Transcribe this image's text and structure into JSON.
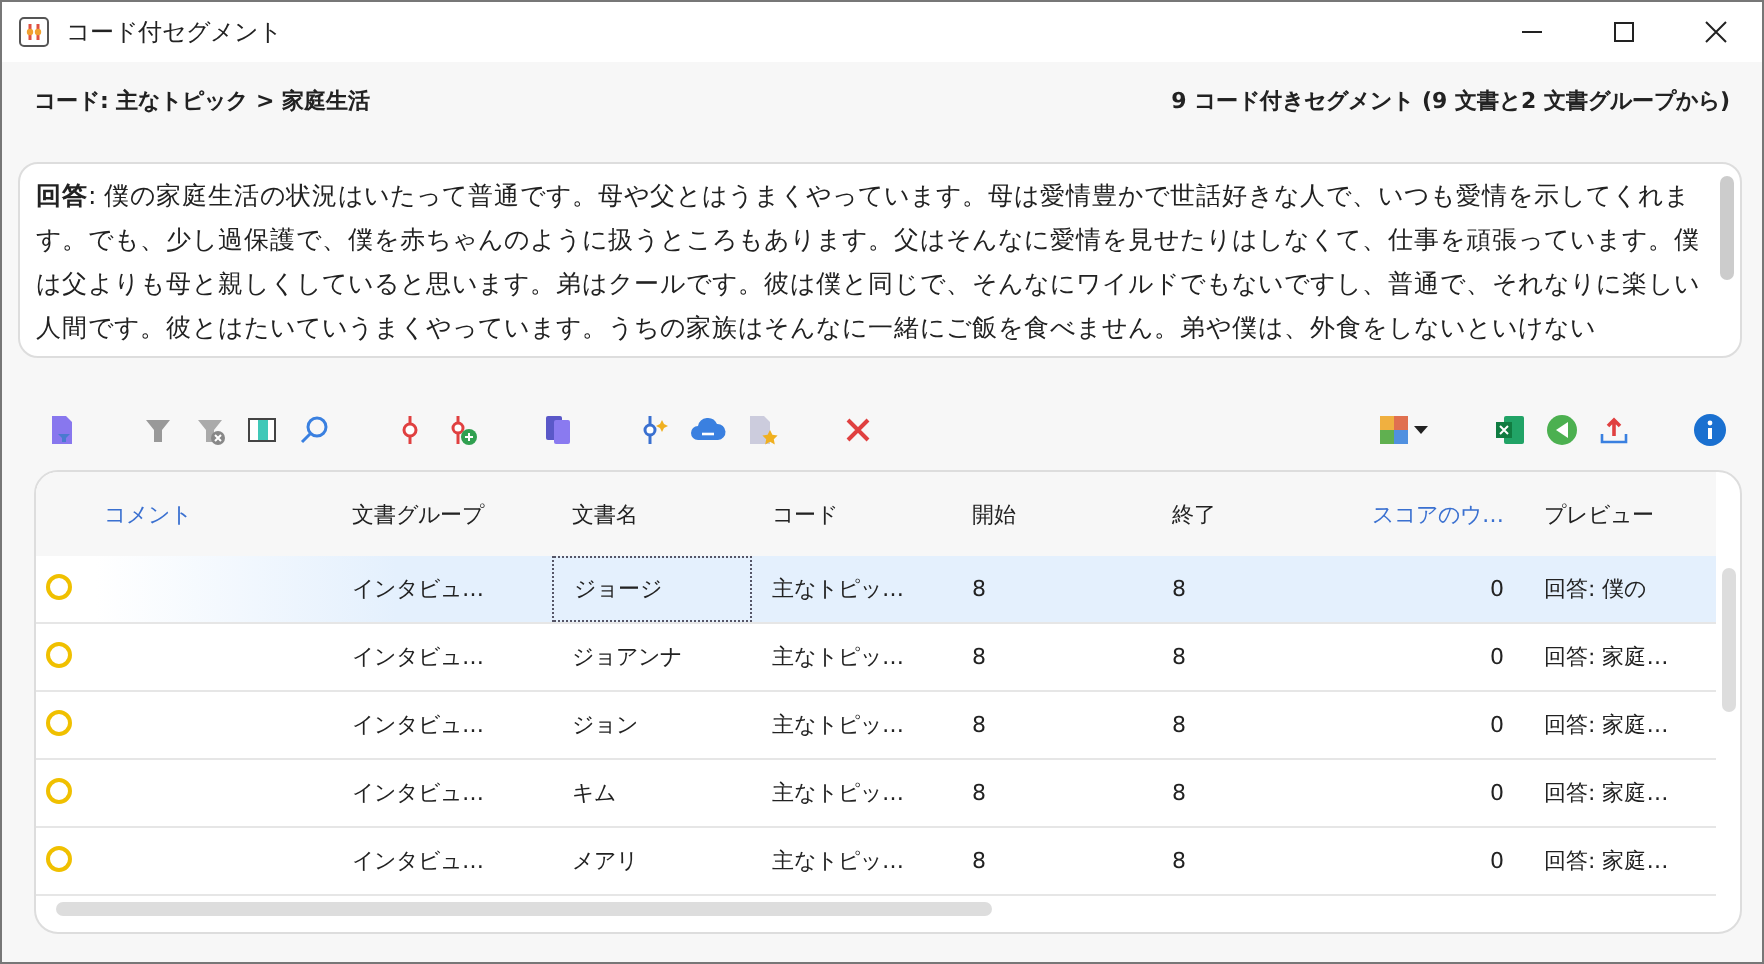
{
  "window": {
    "title": "コード付セグメント"
  },
  "header": {
    "breadcrumb": "コード: 主なトピック > 家庭生活",
    "summary": "9 コード付きセグメント (9 文書と2 文書グループから)"
  },
  "segment_text": "**回答**: 僕の家庭生活の状況はいたって普通です。母や父とはうまくやっています。母は愛情豊かで世話好きな人で、いつも愛情を示してくれます。でも、少し過保護で、僕を赤ちゃんのように扱うところもあります。父はそんなに愛情を見せたりはしなくて、仕事を頑張っています。僕は父よりも母と親しくしていると思います。弟はクールです。彼は僕と同じで、そんなにワイルドでもないですし、普通で、それなりに楽しい人間です。彼とはたいていうまくやっています。うちの家族はそんなに一緒にご飯を食べません。弟や僕は、外食をしないといけない",
  "table": {
    "columns": [
      {
        "label": "コメント",
        "link": true
      },
      {
        "label": "文書グループ",
        "link": false
      },
      {
        "label": "文書名",
        "link": false
      },
      {
        "label": "コード",
        "link": false
      },
      {
        "label": "開始",
        "link": false
      },
      {
        "label": "終了",
        "link": false
      },
      {
        "label": "スコアのウ…",
        "link": true
      },
      {
        "label": "プレビュー",
        "link": false
      }
    ],
    "rows": [
      {
        "selected": true,
        "group": "インタビュ…",
        "document": "ジョージ",
        "code": "主なトピッ…",
        "start": "8",
        "end": "8",
        "score": "0",
        "preview": "回答: 僕の"
      },
      {
        "selected": false,
        "group": "インタビュ…",
        "document": "ジョアンナ",
        "code": "主なトピッ…",
        "start": "8",
        "end": "8",
        "score": "0",
        "preview": "回答: 家庭…"
      },
      {
        "selected": false,
        "group": "インタビュ…",
        "document": "ジョン",
        "code": "主なトピッ…",
        "start": "8",
        "end": "8",
        "score": "0",
        "preview": "回答: 家庭…"
      },
      {
        "selected": false,
        "group": "インタビュ…",
        "document": "キム",
        "code": "主なトピッ…",
        "start": "8",
        "end": "8",
        "score": "0",
        "preview": "回答: 家庭…"
      },
      {
        "selected": false,
        "group": "インタビュ…",
        "document": "メアリ",
        "code": "主なトピッ…",
        "start": "8",
        "end": "8",
        "score": "0",
        "preview": "回答: 家庭…"
      }
    ]
  }
}
